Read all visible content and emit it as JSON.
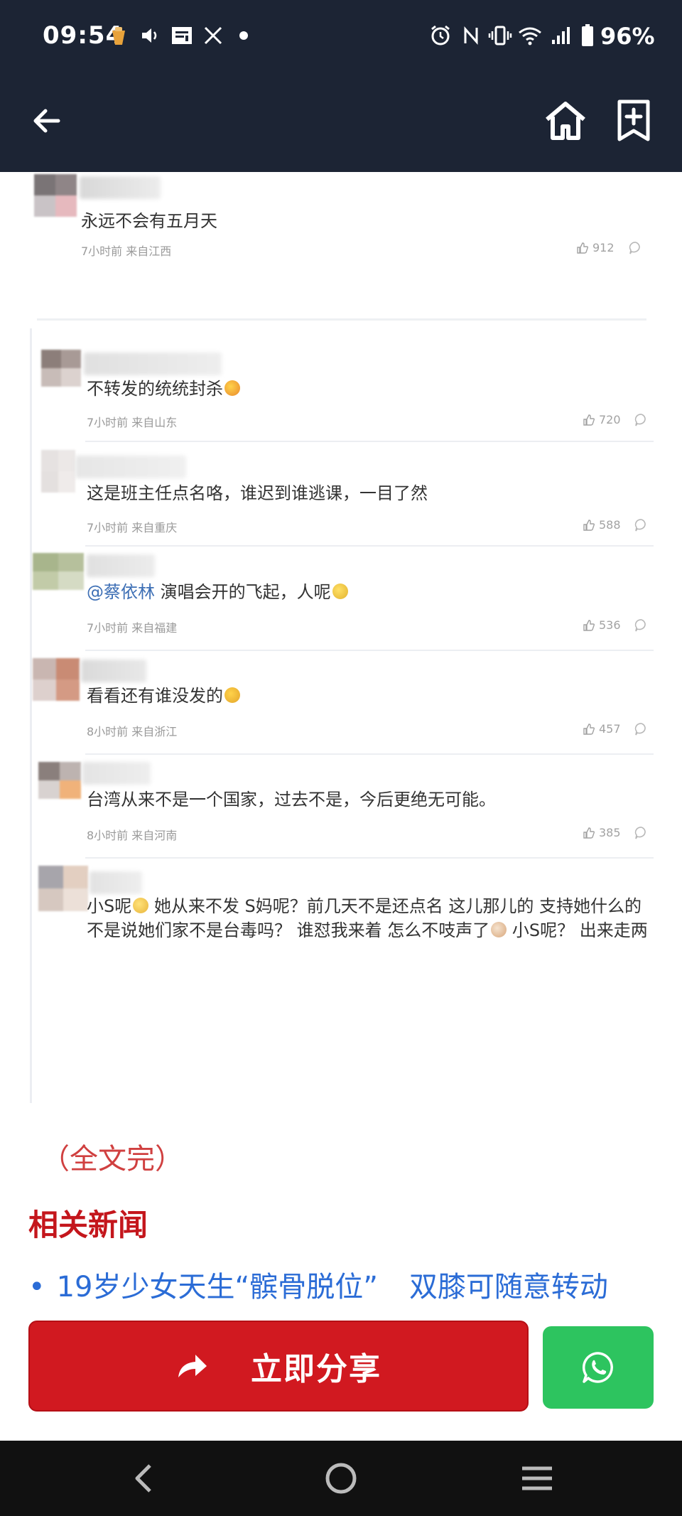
{
  "status_bar": {
    "time": "09:54",
    "battery": "96%",
    "notification_icons": [
      "app-notification-icon",
      "volume-icon",
      "news-app-icon",
      "x-app-icon",
      "dot-icon"
    ],
    "system_icons": [
      "alarm-icon",
      "nfc-icon",
      "vibrate-icon",
      "wifi-icon",
      "signal-icon",
      "battery-icon"
    ]
  },
  "nav": {
    "back_icon": "back-arrow-icon",
    "home_icon": "home-icon",
    "bookmark_icon": "bookmark-add-icon"
  },
  "comments": [
    {
      "text": "永远不会有五月天",
      "meta": "7小时前 来自江西",
      "likes": "912"
    },
    {
      "text": "不转发的统统封杀",
      "meta": "7小时前 来自山东",
      "likes": "720"
    },
    {
      "text": "这是班主任点名咯，谁迟到谁逃课，一目了然",
      "meta": "7小时前 来自重庆",
      "likes": "588"
    },
    {
      "mention": "@蔡依林",
      "text": " 演唱会开的飞起，人呢",
      "meta": "7小时前 来自福建",
      "likes": "536"
    },
    {
      "text": "看看还有谁没发的",
      "meta": "8小时前 来自浙江",
      "likes": "457"
    },
    {
      "text": "台湾从来不是一个国家，过去不是，今后更绝无可能。",
      "meta": "8小时前 来自河南",
      "likes": "385"
    },
    {
      "line1_a": "小S呢",
      "line1_b": " 她从来不发 S妈呢？前几天不是还点名 这儿那儿的 支持她什么的",
      "line2_a": "不是说她们家不是台毒吗？ 谁怼我来着 怎么不吱声了",
      "line2_b": " 小S呢？ 出来走两"
    }
  ],
  "article": {
    "end_text": "（全文完）",
    "related_title": "相关新闻",
    "related_items": [
      {
        "part1": "19岁少女天生“髌骨脱位”",
        "part2": "双膝可随意转动"
      }
    ]
  },
  "share": {
    "label": "立即分享",
    "icon": "share-arrow-icon",
    "whatsapp_icon": "whatsapp-icon"
  },
  "system_nav": {
    "back": "system-back-icon",
    "home": "system-home-icon",
    "recents": "system-recents-icon"
  },
  "colors": {
    "header_bg": "#1c2434",
    "share_red": "#d11920",
    "whatsapp_green": "#2dc45f",
    "related_title": "#c4161c",
    "link_blue": "#2b6cd6"
  }
}
